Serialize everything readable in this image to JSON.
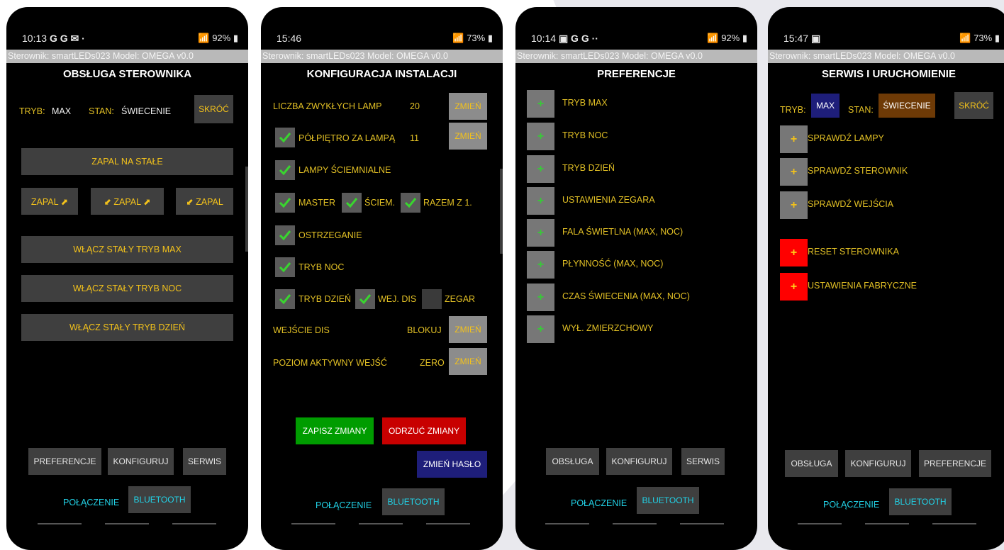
{
  "screen1": {
    "status_time": "10:13",
    "status_icons": "G G ✉ ·",
    "status_right": "92%",
    "info": "Sterownik: smartLEDs023   Model: OMEGA v0.0",
    "title": "OBSŁUGA STEROWNIKA",
    "tryb_label": "TRYB:",
    "tryb_value": "MAX",
    "stan_label": "STAN:",
    "stan_value": "ŚWIECENIE",
    "skroc": "SKRÓĆ",
    "zapal_na_stale": "ZAPAL NA STAŁE",
    "zapal_right": "ZAPAL ⬈",
    "zapal_both": "⬋ ZAPAL ⬈",
    "zapal_left": "⬋ ZAPAL",
    "max": "WŁĄCZ STAŁY TRYB MAX",
    "noc": "WŁĄCZ STAŁY TRYB NOC",
    "dzien": "WŁĄCZ STAŁY TRYB DZIEŃ",
    "nav": [
      "PREFERENCJE",
      "KONFIGURUJ",
      "SERWIS"
    ],
    "polaczenie": "POŁĄCZENIE",
    "bluetooth": "BLUETOOTH"
  },
  "screen2": {
    "status_time": "15:46",
    "status_right": "73%",
    "info": "Sterownik: smartLEDs023   Model: OMEGA v0.0",
    "title": "KONFIGURACJA INSTALACJI",
    "liczba_label": "LICZBA ZWYKŁYCH LAMP",
    "liczba_value": "20",
    "zmien": "ZMIEŃ",
    "polpietro_label": "PÓŁPIĘTRO  ZA LAMPĄ",
    "polpietro_value": "11",
    "lampy_sciemnialne": "LAMPY ŚCIEMNIALNE",
    "master": "MASTER",
    "sciem": "ŚCIEM.",
    "razem": "RAZEM Z 1.",
    "ostrzeganie": "OSTRZEGANIE",
    "tryb_noc": "TRYB NOC",
    "tryb_dzien": "TRYB DZIEŃ",
    "wej_dis": "WEJ. DIS",
    "zegar": "ZEGAR",
    "wejscie_dis": "WEJŚCIE DIS",
    "blokuj": "BLOKUJ",
    "poziom": "POZIOM AKTYWNY WEJŚĆ",
    "zero": "ZERO",
    "zapisz": "ZAPISZ ZMIANY",
    "odrzuc": "ODRZUĆ ZMIANY",
    "haslo": "ZMIEŃ HASŁO",
    "polaczenie": "POŁĄCZENIE",
    "bluetooth": "BLUETOOTH"
  },
  "screen3": {
    "status_time": "10:14",
    "status_icons": "▣ G G ··",
    "status_right": "92%",
    "info": "Sterownik: smartLEDs023   Model: OMEGA v0.0",
    "title": "PREFERENCJE",
    "items": [
      "TRYB MAX",
      "TRYB NOC",
      "TRYB DZIEŃ",
      "USTAWIENIA ZEGARA",
      "FALA ŚWIETLNA (MAX, NOC)",
      "PŁYNNOŚĆ (MAX, NOC)",
      "CZAS ŚWIECENIA (MAX, NOC)",
      "WYŁ. ZMIERZCHOWY"
    ],
    "plus": "+",
    "nav": [
      "OBSŁUGA",
      "KONFIGURUJ",
      "SERWIS"
    ],
    "polaczenie": "POŁĄCZENIE",
    "bluetooth": "BLUETOOTH"
  },
  "screen4": {
    "status_time": "15:47",
    "status_icons": "▣",
    "status_right": "73%",
    "info": "Sterownik: smartLEDs023   Model: OMEGA v0.0",
    "title": "SERWIS I URUCHOMIENIE",
    "tryb_label": "TRYB:",
    "tryb_value": "MAX",
    "stan_label": "STAN:",
    "stan_value": "ŚWIECENIE",
    "skroc": "SKRÓĆ",
    "items": [
      "SPRAWDŹ LAMPY",
      "SPRAWDŹ STEROWNIK",
      "SPRAWDŹ WEJŚCIA"
    ],
    "reset": "RESET STEROWNIKA",
    "fabryczne": "USTAWIENIA FABRYCZNE",
    "plus": "+",
    "nav": [
      "OBSŁUGA",
      "KONFIGURUJ",
      "PREFERENCJE"
    ],
    "polaczenie": "POŁĄCZENIE",
    "bluetooth": "BLUETOOTH"
  },
  "colors": {
    "accent_yellow": "#f3c21b",
    "cyan": "#22d3e8",
    "green": "#009c00",
    "red": "#c80000",
    "navy": "#1e1e7a",
    "brown": "#6e3a06"
  }
}
